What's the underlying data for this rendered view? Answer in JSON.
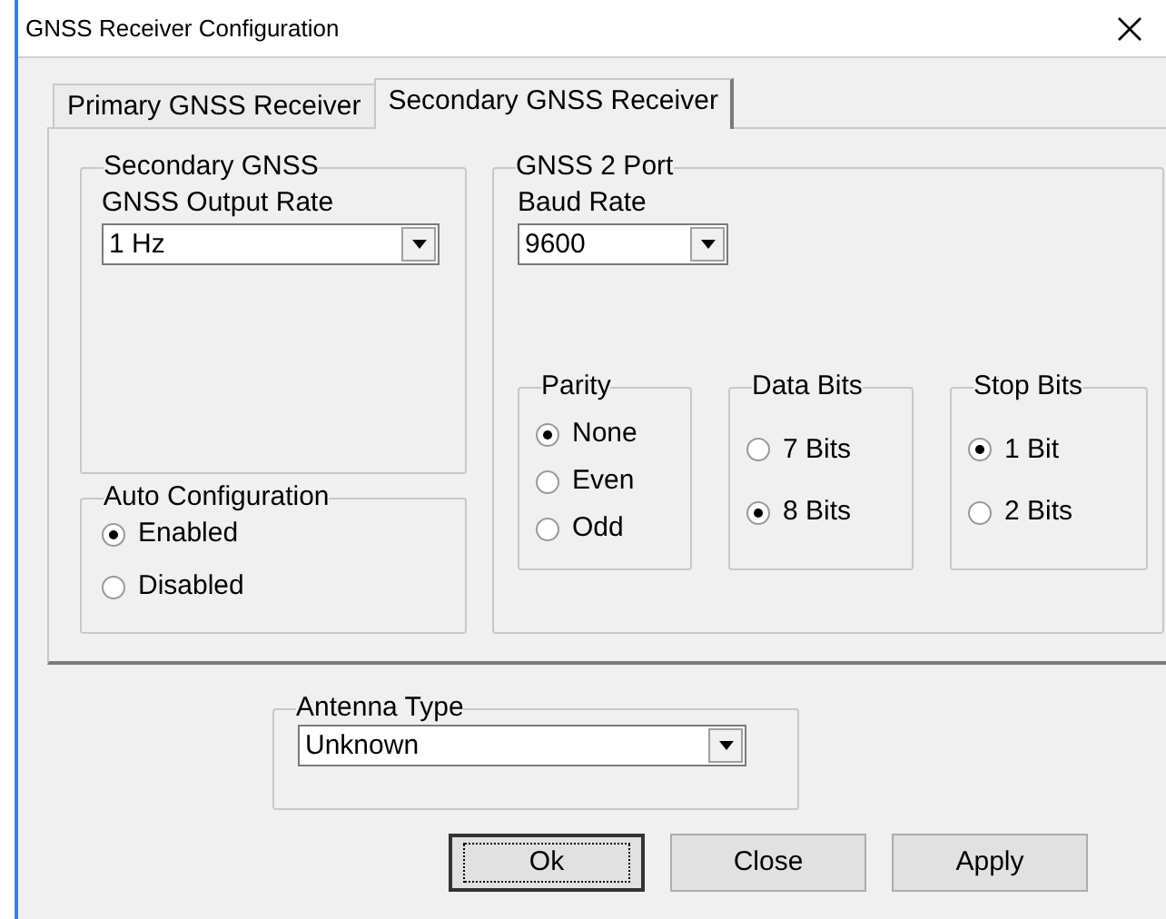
{
  "window": {
    "title": "GNSS Receiver Configuration"
  },
  "tabs": [
    {
      "label": "Primary GNSS Receiver",
      "selected": false
    },
    {
      "label": "Secondary GNSS Receiver",
      "selected": true
    }
  ],
  "secondary_gnss": {
    "title": "Secondary GNSS",
    "output_rate": {
      "label": "GNSS Output Rate",
      "value": "1 Hz"
    }
  },
  "auto_configuration": {
    "title": "Auto Configuration",
    "options": [
      {
        "label": "Enabled",
        "selected": true
      },
      {
        "label": "Disabled",
        "selected": false
      }
    ]
  },
  "gnss2_port": {
    "title": "GNSS 2 Port",
    "baud_rate": {
      "label": "Baud Rate",
      "value": "9600"
    },
    "groups": [
      {
        "title": "Parity",
        "options": [
          {
            "label": "None",
            "selected": true
          },
          {
            "label": "Even",
            "selected": false
          },
          {
            "label": "Odd",
            "selected": false
          }
        ]
      },
      {
        "title": "Data Bits",
        "options": [
          {
            "label": "7 Bits",
            "selected": false
          },
          {
            "label": "8 Bits",
            "selected": true
          }
        ]
      },
      {
        "title": "Stop Bits",
        "options": [
          {
            "label": "1 Bit",
            "selected": true
          },
          {
            "label": "2 Bits",
            "selected": false
          }
        ]
      }
    ]
  },
  "antenna_type": {
    "title": "Antenna Type",
    "value": "Unknown"
  },
  "buttons": [
    {
      "label": "Ok",
      "focused": true
    },
    {
      "label": "Close",
      "focused": false
    },
    {
      "label": "Apply",
      "focused": false
    }
  ]
}
